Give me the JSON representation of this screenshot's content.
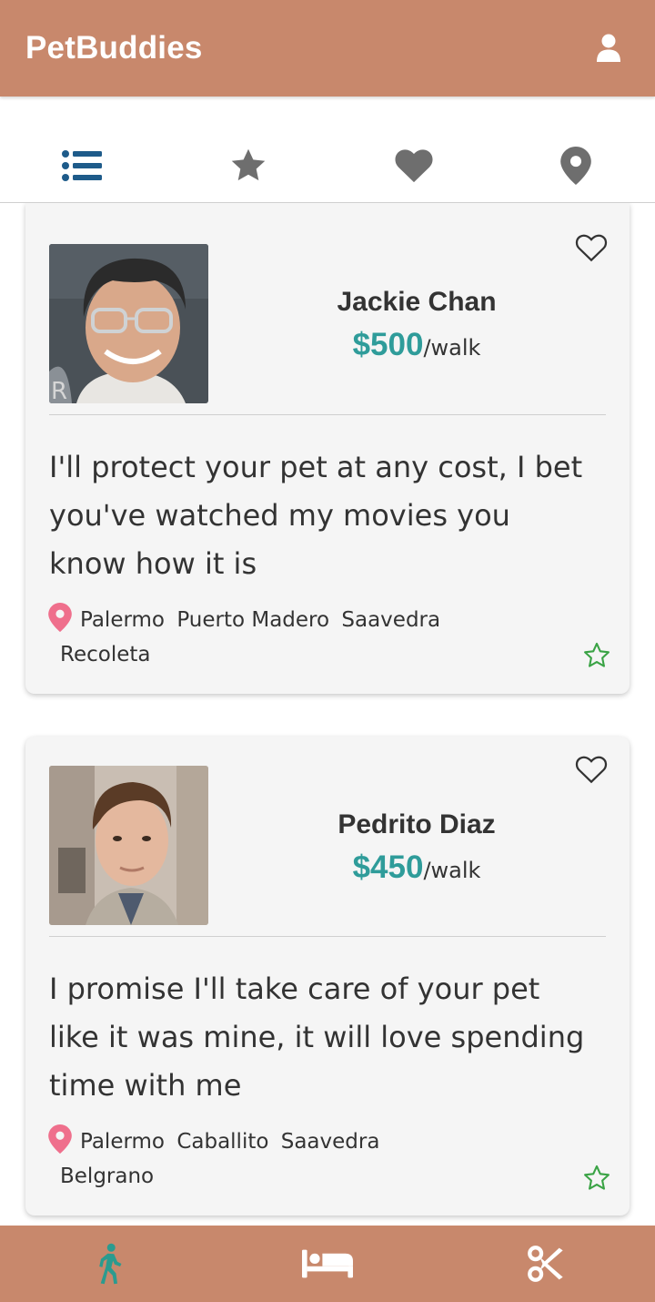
{
  "app": {
    "title": "PetBuddies"
  },
  "header": {
    "profile_icon": "user-icon"
  },
  "tabs": [
    {
      "name": "list",
      "icon": "list-icon",
      "active": true
    },
    {
      "name": "favorites-star",
      "icon": "star-icon",
      "active": false
    },
    {
      "name": "liked",
      "icon": "heart-icon",
      "active": false
    },
    {
      "name": "map",
      "icon": "map-pin-icon",
      "active": false
    }
  ],
  "walkers": [
    {
      "name": "Jackie Chan",
      "price": "$500",
      "unit": "/walk",
      "description": "I'll protect your pet at any cost, I bet you've watched my movies you know how it is",
      "locations": [
        "Palermo",
        "Puerto Madero",
        "Saavedra",
        "Recoleta"
      ]
    },
    {
      "name": "Pedrito Diaz",
      "price": "$450",
      "unit": "/walk",
      "description": "I promise I'll take care of your pet like it was mine, it will love spending time with me",
      "locations": [
        "Palermo",
        "Caballito",
        "Saavedra",
        "Belgrano"
      ]
    }
  ],
  "bottom_nav": [
    {
      "name": "walking",
      "icon": "walking-icon",
      "active": true
    },
    {
      "name": "boarding",
      "icon": "bed-icon",
      "active": false
    },
    {
      "name": "grooming",
      "icon": "scissors-icon",
      "active": false
    }
  ],
  "colors": {
    "brand": "#c8886c",
    "price": "#2f9c9a",
    "active_tab": "#1e5b8a",
    "inactive_tab": "#6e6e6e",
    "pin": "#ef6f8c",
    "rating_star": "#3aa345",
    "active_nav": "#2b9b8f"
  }
}
